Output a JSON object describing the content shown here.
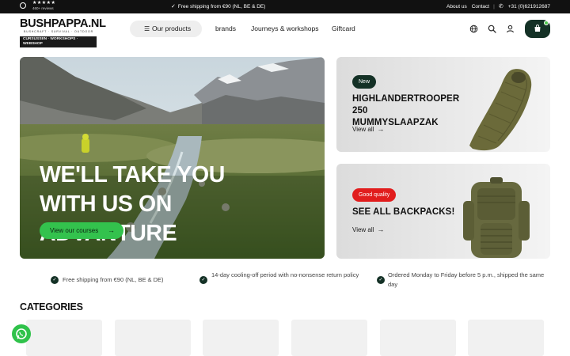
{
  "topbar": {
    "rating_stars": "★★★★★",
    "rating_reviews": "460+ reviews",
    "shipping_text": "Free shipping from €90 (NL, BE & DE)",
    "about_label": "About us",
    "contact_label": "Contact",
    "phone": "+31 (0)621912687"
  },
  "logo": {
    "name": "BUSHPAPPA.NL",
    "tagline": "BUSHCRAFT · SURVIVAL · OUTDOOR",
    "subtag": "CURSUSSEN · WORKSHOPS · WEBSHOP"
  },
  "nav": {
    "products_label": "Our products",
    "brands_label": "brands",
    "journeys_label": "Journeys & workshops",
    "giftcard_label": "Giftcard"
  },
  "icons": {
    "globe": "globe-icon",
    "search": "search-icon",
    "account": "user-icon",
    "cart": "cart-icon",
    "whatsapp": "whatsapp-icon"
  },
  "hero": {
    "headline": "WE'LL TAKE YOU WITH US ON ADVANTURE",
    "cta_label": "View our courses"
  },
  "promos": [
    {
      "badge": "New",
      "badge_color": "#143126",
      "title": "HIGHLANDERTROOPER 250 MUMMYSLAAPZAK",
      "link": "View all"
    },
    {
      "badge": "Good quality",
      "badge_color": "#e11d1d",
      "title": "SEE ALL BACKPACKS!",
      "link": "View all"
    }
  ],
  "usps": [
    "Free shipping from €90 (NL, BE & DE)",
    "14-day cooling-off period with no-nonsense return policy",
    "Ordered Monday to Friday before 5 p.m., shipped the same day"
  ],
  "categories": {
    "title": "CATEGORIES",
    "tile_count_visible": 6
  },
  "colors": {
    "brand_dark_green": "#143126",
    "cta_green": "#33c24d",
    "badge_red": "#e11d1d",
    "whatsapp_green": "#2fc24a"
  }
}
